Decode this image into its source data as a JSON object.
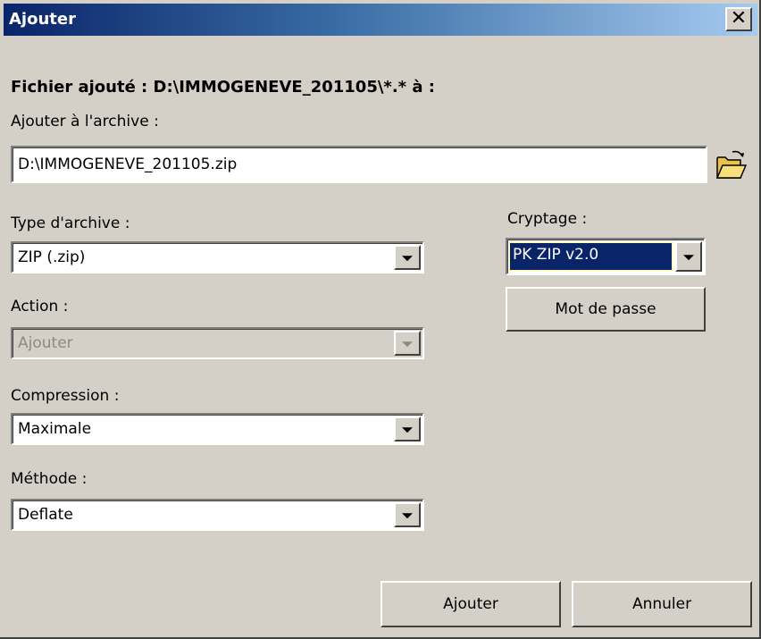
{
  "window": {
    "title": "Ajouter",
    "close_symbol": "✕"
  },
  "header": {
    "file_added_label": "Fichier ajouté : D:\\IMMOGENEVE_201105\\*.* à :"
  },
  "archive": {
    "label": "Ajouter à l'archive :",
    "value": "D:\\IMMOGENEVE_201105.zip"
  },
  "archive_type": {
    "label": "Type d'archive :",
    "value": "ZIP (.zip)"
  },
  "action": {
    "label": "Action :",
    "value": "Ajouter",
    "disabled": true
  },
  "compression": {
    "label": "Compression :",
    "value": "Maximale"
  },
  "method": {
    "label": "Méthode :",
    "value": "Deflate"
  },
  "encryption": {
    "label": "Cryptage :",
    "value": "PK ZIP v2.0",
    "password_button": "Mot de passe"
  },
  "buttons": {
    "ok": "Ajouter",
    "cancel": "Annuler"
  },
  "colors": {
    "dialog_bg": "#d4d0c8",
    "titlebar_start": "#0a246a",
    "titlebar_end": "#a6caf0",
    "selection": "#0a246a"
  }
}
